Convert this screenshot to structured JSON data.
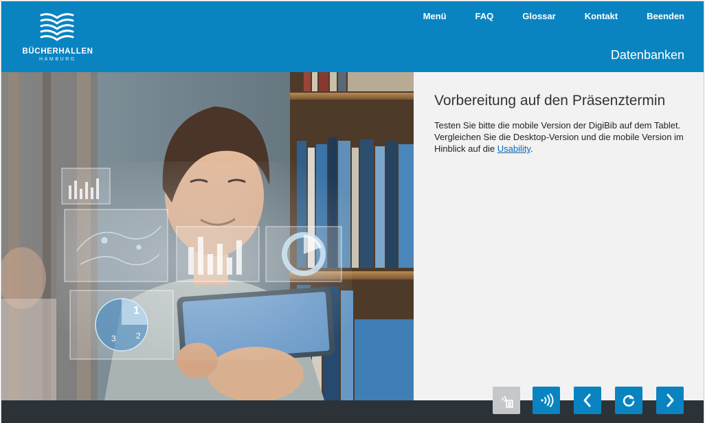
{
  "brand": {
    "name": "BÜCHERHALLEN",
    "city": "HAMBURG"
  },
  "nav": {
    "items": [
      "Menü",
      "FAQ",
      "Glossar",
      "Kontakt",
      "Beenden"
    ]
  },
  "header": {
    "section_title": "Datenbanken"
  },
  "content": {
    "title": "Vorbereitung auf den Präsenztermin",
    "text_before_link": "Testen Sie bitte die mobile Version der DigiBib auf dem Tablet. Vergleichen Sie die Desktop-Version und die mobile Version im Hinblick auf die ",
    "link_text": "Usability",
    "text_after_link": "."
  },
  "controls": [
    {
      "name": "transcript-button",
      "icon": "transcript-icon",
      "state": "disabled"
    },
    {
      "name": "audio-button",
      "icon": "audio-wave-icon",
      "state": "enabled"
    },
    {
      "name": "previous-button",
      "icon": "chevron-left-icon",
      "state": "enabled"
    },
    {
      "name": "replay-button",
      "icon": "replay-icon",
      "state": "enabled"
    },
    {
      "name": "next-button",
      "icon": "chevron-right-icon",
      "state": "enabled"
    }
  ],
  "colors": {
    "header": "#0a84c1",
    "panel": "#f2f2f2",
    "footer": "#2b3338",
    "button": "#0a84c1",
    "button_disabled": "#c4c8ca",
    "link": "#0a66b5"
  }
}
